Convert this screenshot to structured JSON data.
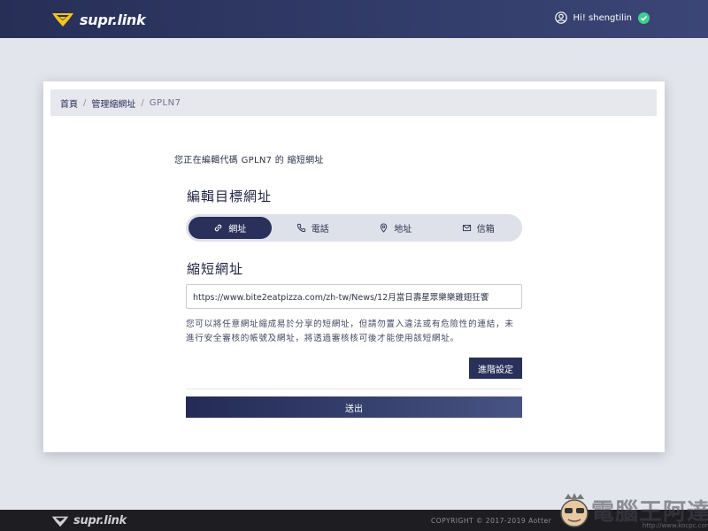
{
  "header": {
    "logo_text": "supr.link",
    "greeting": "Hi! shengtilin"
  },
  "breadcrumb": {
    "home": "首頁",
    "manage": "管理縮網址",
    "current": "GPLN7",
    "separator": "/"
  },
  "main": {
    "intro": "您正在編輯代碼 GPLN7 的 縮短網址",
    "edit_title": "編輯目標網址",
    "tabs": [
      {
        "label": "網址",
        "icon": "link-icon",
        "active": true
      },
      {
        "label": "電話",
        "icon": "phone-icon",
        "active": false
      },
      {
        "label": "地址",
        "icon": "map-pin-icon",
        "active": false
      },
      {
        "label": "信箱",
        "icon": "mail-icon",
        "active": false
      }
    ],
    "short_title": "縮短網址",
    "url_value": "https://www.bite2eatpizza.com/zh-tw/News/12月當日壽星眾樂樂雞翅狂饗",
    "help_text": "您可以將任意網址縮成易於分享的短網址，但請勿置入違法或有危險性的連結，未進行安全審核的帳號及網址，將透過審核核可後才能使用該短網址。",
    "advanced_label": "進階設定",
    "submit_label": "送出"
  },
  "footer": {
    "logo_text": "supr.link",
    "copyright": "COPYRIGHT © 2017-2019 Aotter"
  },
  "watermark": {
    "text": "電腦王阿達",
    "url": "http://www.kocpc.com.tw"
  },
  "colors": {
    "primary": "#29305a",
    "header_start": "#272f57",
    "header_end": "#3b4677",
    "verified": "#3ecf8e",
    "logo_yellow": "#f5c518"
  }
}
